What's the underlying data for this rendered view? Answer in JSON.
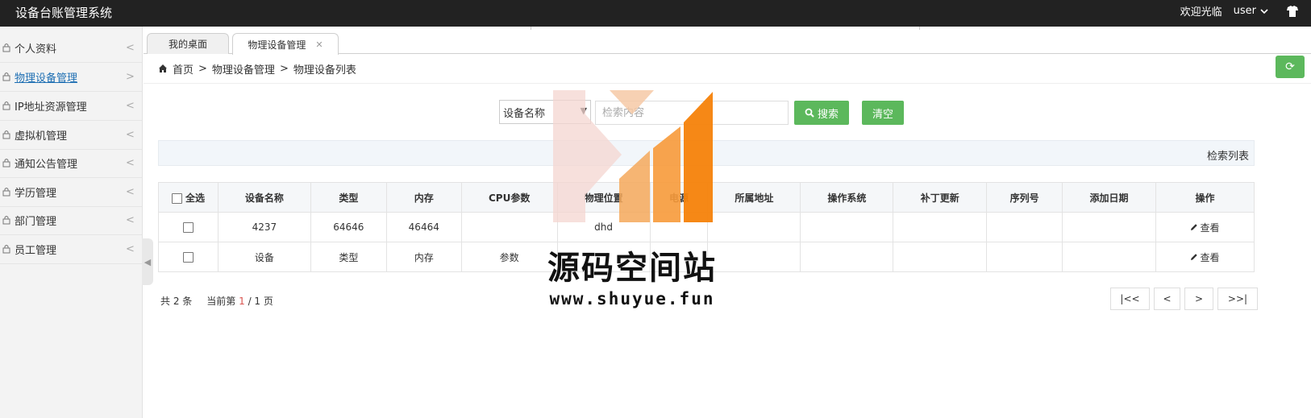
{
  "header": {
    "app_title": "设备台账管理系统",
    "welcome": "欢迎光临",
    "user": "user"
  },
  "sidebar": {
    "items": [
      {
        "label": "个人资料",
        "chevron": "<"
      },
      {
        "label": "物理设备管理",
        "chevron": ">"
      },
      {
        "label": "IP地址资源管理",
        "chevron": "<"
      },
      {
        "label": "虚拟机管理",
        "chevron": "<"
      },
      {
        "label": "通知公告管理",
        "chevron": "<"
      },
      {
        "label": "学历管理",
        "chevron": "<"
      },
      {
        "label": "部门管理",
        "chevron": "<"
      },
      {
        "label": "员工管理",
        "chevron": "<"
      }
    ]
  },
  "tabs": [
    {
      "label": "我的桌面"
    },
    {
      "label": "物理设备管理"
    }
  ],
  "breadcrumb": {
    "home": "首页",
    "level1": "物理设备管理",
    "level2": "物理设备列表",
    "sep": ">"
  },
  "search": {
    "field_selected": "设备名称",
    "placeholder": "检索内容",
    "search_label": "搜索",
    "clear_label": "清空"
  },
  "result_banner": "检索列表",
  "table": {
    "select_all": "全选",
    "columns": [
      "设备名称",
      "类型",
      "内存",
      "CPU参数",
      "物理位置",
      "电源",
      "所属地址",
      "操作系统",
      "补丁更新",
      "序列号",
      "添加日期",
      "操作"
    ],
    "rows": [
      {
        "name": "4237",
        "type": "64646",
        "memory": "46464",
        "cpu": "",
        "location": "dhd",
        "power": "",
        "address": "",
        "os": "",
        "patch": "",
        "serial": "",
        "date": "",
        "action": "查看"
      },
      {
        "name": "设备",
        "type": "类型",
        "memory": "内存",
        "cpu": "参数",
        "location": "",
        "power": "",
        "address": "",
        "os": "",
        "patch": "",
        "serial": "",
        "date": "",
        "action": "查看"
      }
    ]
  },
  "pagination": {
    "total": "共 2 条",
    "current_prefix": "当前第",
    "current": "1",
    "total_pages": "/ 1 页",
    "first": "|<<",
    "prev": "<",
    "next": ">",
    "last": ">>|"
  },
  "watermark": {
    "title": "源码空间站",
    "url": "www.shuyue.fun"
  },
  "colors": {
    "topbar": "#222222",
    "accent_green": "#5cb85c",
    "link_blue": "#1e6fb3",
    "page_current": "#d9534f"
  }
}
